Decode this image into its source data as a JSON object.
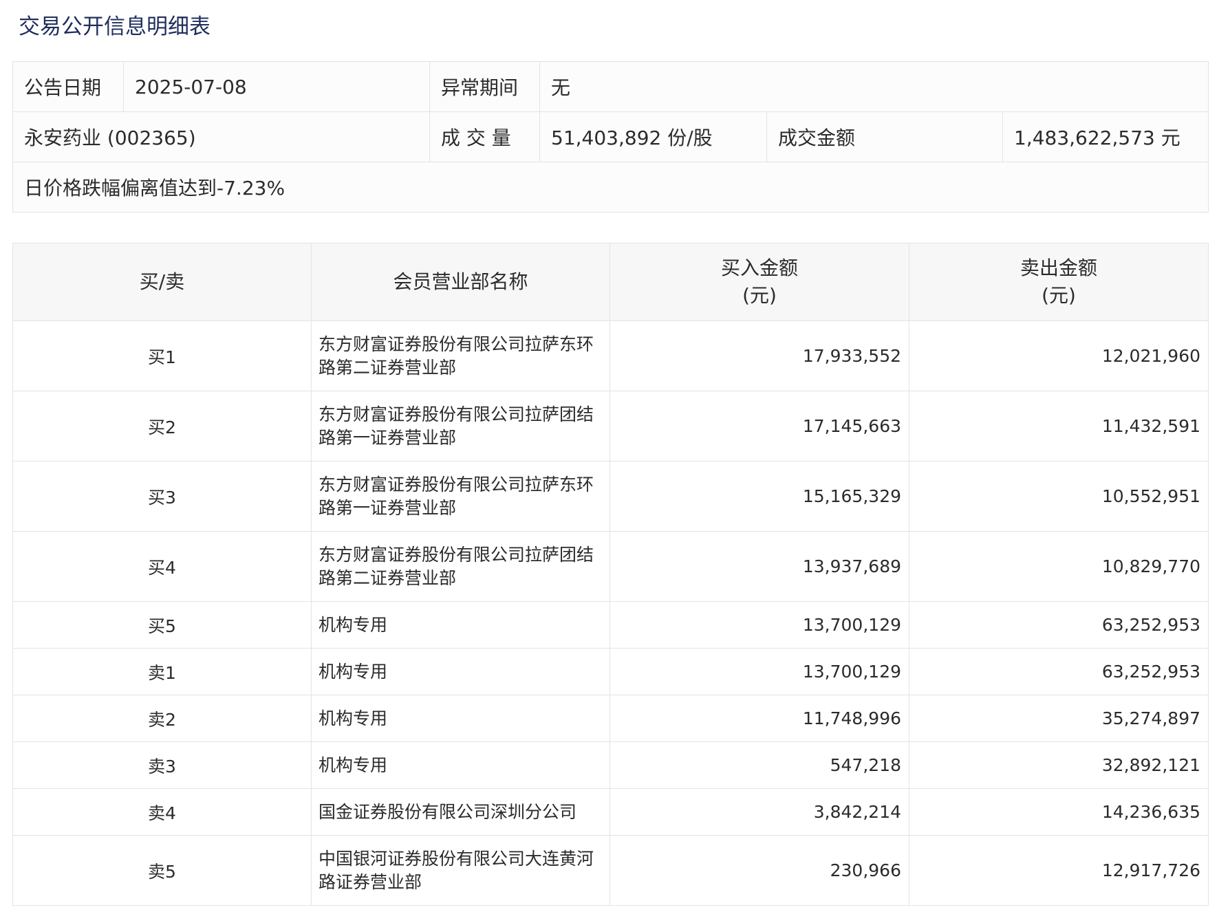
{
  "title": "交易公开信息明细表",
  "summary": {
    "announce_date_label": "公告日期",
    "announce_date_value": "2025-07-08",
    "abnormal_period_label": "异常期间",
    "abnormal_period_value": "无",
    "stock_name": "永安药业 (002365)",
    "volume_label": "成 交 量",
    "volume_value": "51,403,892 份/股",
    "amount_label": "成交金额",
    "amount_value": "1,483,622,573 元",
    "reason": "日价格跌幅偏离值达到-7.23%"
  },
  "table": {
    "headers": {
      "side": "买/卖",
      "name": "会员营业部名称",
      "buy_line1": "买入金额",
      "buy_line2": "(元)",
      "sell_line1": "卖出金额",
      "sell_line2": "(元)"
    },
    "rows": [
      {
        "side": "买1",
        "name": "东方财富证券股份有限公司拉萨东环路第二证券营业部",
        "buy": "17,933,552",
        "sell": "12,021,960"
      },
      {
        "side": "买2",
        "name": "东方财富证券股份有限公司拉萨团结路第一证券营业部",
        "buy": "17,145,663",
        "sell": "11,432,591"
      },
      {
        "side": "买3",
        "name": "东方财富证券股份有限公司拉萨东环路第一证券营业部",
        "buy": "15,165,329",
        "sell": "10,552,951"
      },
      {
        "side": "买4",
        "name": "东方财富证券股份有限公司拉萨团结路第二证券营业部",
        "buy": "13,937,689",
        "sell": "10,829,770"
      },
      {
        "side": "买5",
        "name": "机构专用",
        "buy": "13,700,129",
        "sell": "63,252,953"
      },
      {
        "side": "卖1",
        "name": "机构专用",
        "buy": "13,700,129",
        "sell": "63,252,953"
      },
      {
        "side": "卖2",
        "name": "机构专用",
        "buy": "11,748,996",
        "sell": "35,274,897"
      },
      {
        "side": "卖3",
        "name": "机构专用",
        "buy": "547,218",
        "sell": "32,892,121"
      },
      {
        "side": "卖4",
        "name": "国金证券股份有限公司深圳分公司",
        "buy": "3,842,214",
        "sell": "14,236,635"
      },
      {
        "side": "卖5",
        "name": "中国银河证券股份有限公司大连黄河路证券营业部",
        "buy": "230,966",
        "sell": "12,917,726"
      }
    ]
  }
}
